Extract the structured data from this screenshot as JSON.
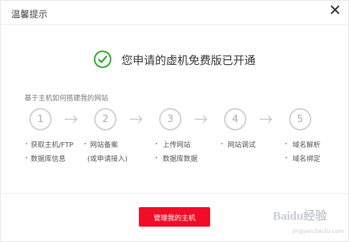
{
  "dialog": {
    "title": "温馨提示",
    "close_icon": "close-icon"
  },
  "success": {
    "icon": "check-circle-icon",
    "message": "您申请的虚机免费版已开通",
    "color": "#1aaa1a"
  },
  "guide": {
    "heading": "基于主机如何搭建我的网站",
    "steps": [
      {
        "number": "1",
        "items": [
          "获取主机/FTP",
          "数据库信息"
        ]
      },
      {
        "number": "2",
        "items": [
          "网站备案",
          "(或申请接入)"
        ]
      },
      {
        "number": "3",
        "items": [
          "上传网站",
          "数据库数据"
        ]
      },
      {
        "number": "4",
        "items": [
          "网站调试"
        ]
      },
      {
        "number": "5",
        "items": [
          "域名解析",
          "域名绑定"
        ]
      }
    ]
  },
  "footer": {
    "manage_button": "管理我的主机",
    "button_color": "#f20c26"
  },
  "watermark": {
    "logo": "Baidu经验",
    "url": "jingyan.baidu.com"
  }
}
